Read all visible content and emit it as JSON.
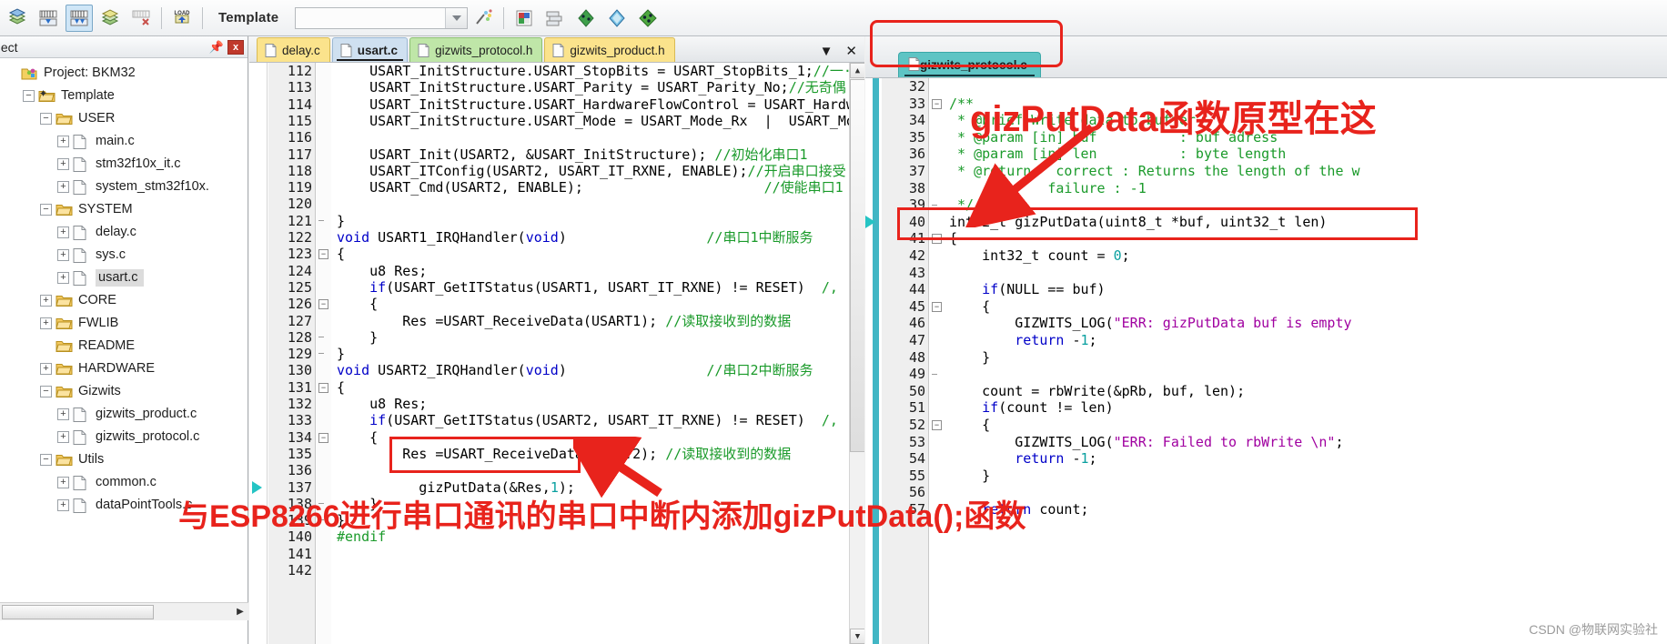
{
  "toolbar": {
    "template_label": "Template",
    "combo_value": "",
    "icons": [
      {
        "name": "build-target-icon"
      },
      {
        "name": "build-icon"
      },
      {
        "name": "rebuild-icon"
      },
      {
        "name": "batch-build-icon"
      },
      {
        "name": "stop-build-icon"
      },
      {
        "name": "load-icon",
        "label": "LOAD"
      },
      {
        "name": "target-options-icon"
      },
      {
        "name": "manage-components-icon"
      },
      {
        "name": "manage-project-items-icon"
      },
      {
        "name": "configuration-wizard-icon"
      },
      {
        "name": "pack-installer-icon"
      },
      {
        "name": "manage-run-time-icon"
      }
    ]
  },
  "project_panel": {
    "title": "oject",
    "close_label": "x",
    "tree": [
      {
        "label": "Project: BKM32",
        "depth": 0,
        "expander": "",
        "icon": "project-icon"
      },
      {
        "label": "Template",
        "depth": 1,
        "expander": "-",
        "icon": "target-folder-icon"
      },
      {
        "label": "USER",
        "depth": 2,
        "expander": "-",
        "icon": "folder-icon"
      },
      {
        "label": "main.c",
        "depth": 3,
        "expander": "+",
        "icon": "c-file-icon"
      },
      {
        "label": "stm32f10x_it.c",
        "depth": 3,
        "expander": "+",
        "icon": "c-file-icon"
      },
      {
        "label": "system_stm32f10x.",
        "depth": 3,
        "expander": "+",
        "icon": "c-file-icon"
      },
      {
        "label": "SYSTEM",
        "depth": 2,
        "expander": "-",
        "icon": "folder-icon"
      },
      {
        "label": "delay.c",
        "depth": 3,
        "expander": "+",
        "icon": "c-file-icon"
      },
      {
        "label": "sys.c",
        "depth": 3,
        "expander": "+",
        "icon": "c-file-icon"
      },
      {
        "label": "usart.c",
        "depth": 3,
        "expander": "+",
        "icon": "c-file-icon",
        "selected": true
      },
      {
        "label": "CORE",
        "depth": 2,
        "expander": "+",
        "icon": "folder-icon"
      },
      {
        "label": "FWLIB",
        "depth": 2,
        "expander": "+",
        "icon": "folder-icon"
      },
      {
        "label": "README",
        "depth": 2,
        "expander": "",
        "icon": "folder-icon"
      },
      {
        "label": "HARDWARE",
        "depth": 2,
        "expander": "+",
        "icon": "folder-icon"
      },
      {
        "label": "Gizwits",
        "depth": 2,
        "expander": "-",
        "icon": "folder-icon"
      },
      {
        "label": "gizwits_product.c",
        "depth": 3,
        "expander": "+",
        "icon": "c-file-icon"
      },
      {
        "label": "gizwits_protocol.c",
        "depth": 3,
        "expander": "+",
        "icon": "c-file-icon"
      },
      {
        "label": "Utils",
        "depth": 2,
        "expander": "-",
        "icon": "folder-icon"
      },
      {
        "label": "common.c",
        "depth": 3,
        "expander": "+",
        "icon": "c-file-icon"
      },
      {
        "label": "dataPointTools.c",
        "depth": 3,
        "expander": "+",
        "icon": "c-file-icon"
      }
    ]
  },
  "left_editor": {
    "tabs": [
      {
        "label": "delay.c",
        "color": "yellow",
        "active": false
      },
      {
        "label": "usart.c",
        "color": "blue",
        "active": true
      },
      {
        "label": "gizwits_protocol.h",
        "color": "green",
        "active": false
      },
      {
        "label": "gizwits_product.h",
        "color": "yellow2",
        "active": false
      }
    ],
    "tab_menu_icon": "tab-list-icon",
    "tab_close_icon": "close-icon",
    "first_line": 112,
    "lines": [
      {
        "n": 112,
        "segs": [
          {
            "t": "    USART_InitStructure.USART_StopBits = USART_StopBits_1;",
            "c": ""
          },
          {
            "t": "//一·",
            "c": "cmt"
          }
        ]
      },
      {
        "n": 113,
        "segs": [
          {
            "t": "    USART_InitStructure.USART_Parity = USART_Parity_No;",
            "c": ""
          },
          {
            "t": "//无奇偶",
            "c": "cmt"
          }
        ]
      },
      {
        "n": 114,
        "segs": [
          {
            "t": "    USART_InitStructure.USART_HardwareFlowControl = USART_Hardw",
            "c": ""
          }
        ]
      },
      {
        "n": 115,
        "segs": [
          {
            "t": "    USART_InitStructure.USART_Mode = USART_Mode_Rx  |  USART_Mod",
            "c": ""
          }
        ]
      },
      {
        "n": 116,
        "segs": []
      },
      {
        "n": 117,
        "segs": [
          {
            "t": "    USART_Init(USART2, &USART_InitStructure); ",
            "c": ""
          },
          {
            "t": "//初始化串口1",
            "c": "cmt"
          }
        ]
      },
      {
        "n": 118,
        "segs": [
          {
            "t": "    USART_ITConfig(USART2, USART_IT_RXNE, ENABLE);",
            "c": ""
          },
          {
            "t": "//开启串口接受",
            "c": "cmt"
          }
        ]
      },
      {
        "n": 119,
        "segs": [
          {
            "t": "    USART_Cmd(USART2, ENABLE);                      ",
            "c": ""
          },
          {
            "t": "//使能串口1",
            "c": "cmt"
          }
        ]
      },
      {
        "n": 120,
        "segs": []
      },
      {
        "n": 121,
        "fold": "end",
        "segs": [
          {
            "t": "}",
            "c": ""
          }
        ]
      },
      {
        "n": 122,
        "segs": [
          {
            "t": "void",
            "c": "kw"
          },
          {
            "t": " USART1_IRQHandler(",
            "c": ""
          },
          {
            "t": "void",
            "c": "kw"
          },
          {
            "t": ")                 ",
            "c": ""
          },
          {
            "t": "//串口1中断服务",
            "c": "cmt"
          }
        ]
      },
      {
        "n": 123,
        "fold": "start",
        "segs": [
          {
            "t": "{",
            "c": ""
          }
        ]
      },
      {
        "n": 124,
        "segs": [
          {
            "t": "    u8 Res;",
            "c": ""
          }
        ]
      },
      {
        "n": 125,
        "segs": [
          {
            "t": "    ",
            "c": ""
          },
          {
            "t": "if",
            "c": "kw"
          },
          {
            "t": "(USART_GetITStatus(USART1, USART_IT_RXNE) != RESET)  ",
            "c": ""
          },
          {
            "t": "/,",
            "c": "cmt"
          }
        ]
      },
      {
        "n": 126,
        "fold": "start",
        "segs": [
          {
            "t": "    {",
            "c": ""
          }
        ]
      },
      {
        "n": 127,
        "segs": [
          {
            "t": "        Res =USART_ReceiveData(USART1); ",
            "c": ""
          },
          {
            "t": "//读取接收到的数据",
            "c": "cmt"
          }
        ]
      },
      {
        "n": 128,
        "fold": "end",
        "segs": [
          {
            "t": "    }",
            "c": ""
          }
        ]
      },
      {
        "n": 129,
        "fold": "end",
        "segs": [
          {
            "t": "}",
            "c": ""
          }
        ]
      },
      {
        "n": 130,
        "segs": [
          {
            "t": "void",
            "c": "kw"
          },
          {
            "t": " USART2_IRQHandler(",
            "c": ""
          },
          {
            "t": "void",
            "c": "kw"
          },
          {
            "t": ")                 ",
            "c": ""
          },
          {
            "t": "//串口2中断服务",
            "c": "cmt"
          }
        ]
      },
      {
        "n": 131,
        "fold": "start",
        "segs": [
          {
            "t": "{",
            "c": ""
          }
        ]
      },
      {
        "n": 132,
        "segs": [
          {
            "t": "    u8 Res;",
            "c": ""
          }
        ]
      },
      {
        "n": 133,
        "segs": [
          {
            "t": "    ",
            "c": ""
          },
          {
            "t": "if",
            "c": "kw"
          },
          {
            "t": "(USART_GetITStatus(USART2, USART_IT_RXNE) != RESET)  ",
            "c": ""
          },
          {
            "t": "/,",
            "c": "cmt"
          }
        ]
      },
      {
        "n": 134,
        "fold": "start",
        "segs": [
          {
            "t": "    {",
            "c": ""
          }
        ]
      },
      {
        "n": 135,
        "segs": [
          {
            "t": "        Res =USART_ReceiveData(USART2); ",
            "c": ""
          },
          {
            "t": "//读取接收到的数据",
            "c": "cmt"
          }
        ]
      },
      {
        "n": 136,
        "segs": []
      },
      {
        "n": 137,
        "marker": true,
        "segs": [
          {
            "t": "          gizPutData(&Res,",
            "c": ""
          },
          {
            "t": "1",
            "c": "num"
          },
          {
            "t": ");",
            "c": ""
          }
        ]
      },
      {
        "n": 138,
        "fold": "end",
        "segs": [
          {
            "t": "    }",
            "c": ""
          }
        ]
      },
      {
        "n": 139,
        "fold": "end",
        "segs": [
          {
            "t": "}",
            "c": ""
          }
        ]
      },
      {
        "n": 140,
        "segs": [
          {
            "t": "#endif",
            "c": "cmt"
          }
        ]
      },
      {
        "n": 141,
        "segs": []
      },
      {
        "n": 142,
        "segs": []
      }
    ]
  },
  "right_editor": {
    "tab": {
      "label": "gizwits_protocol.c",
      "color": "teal"
    },
    "lines": [
      {
        "n": 32,
        "segs": []
      },
      {
        "n": 33,
        "fold": "start",
        "segs": [
          {
            "t": "/**",
            "c": "cmt"
          }
        ]
      },
      {
        "n": 34,
        "segs": [
          {
            "t": " * @brief Write data to buffer",
            "c": "cmt"
          }
        ]
      },
      {
        "n": 35,
        "segs": [
          {
            "t": " * @param [in] buf          : buf adress",
            "c": "cmt"
          }
        ]
      },
      {
        "n": 36,
        "segs": [
          {
            "t": " * @param [in] len          : byte length",
            "c": "cmt"
          }
        ]
      },
      {
        "n": 37,
        "segs": [
          {
            "t": " * @return   correct : Returns the length of the w",
            "c": "cmt"
          }
        ]
      },
      {
        "n": 38,
        "segs": [
          {
            "t": "            failure : -1",
            "c": "cmt"
          }
        ]
      },
      {
        "n": 39,
        "fold": "end",
        "segs": [
          {
            "t": " */",
            "c": "cmt"
          }
        ]
      },
      {
        "n": 40,
        "marker": true,
        "segs": [
          {
            "t": "int32_t gizPutData(uint8_t *buf, uint32_t len)",
            "c": ""
          }
        ]
      },
      {
        "n": 41,
        "fold": "start",
        "segs": [
          {
            "t": "{",
            "c": ""
          }
        ]
      },
      {
        "n": 42,
        "segs": [
          {
            "t": "    int32_t count = ",
            "c": ""
          },
          {
            "t": "0",
            "c": "num"
          },
          {
            "t": ";",
            "c": ""
          }
        ]
      },
      {
        "n": 43,
        "segs": []
      },
      {
        "n": 44,
        "segs": [
          {
            "t": "    ",
            "c": ""
          },
          {
            "t": "if",
            "c": "kw"
          },
          {
            "t": "(NULL == buf)",
            "c": ""
          }
        ]
      },
      {
        "n": 45,
        "fold": "start",
        "segs": [
          {
            "t": "    {",
            "c": ""
          }
        ]
      },
      {
        "n": 46,
        "segs": [
          {
            "t": "        GIZWITS_LOG(",
            "c": ""
          },
          {
            "t": "\"ERR: gizPutData buf is empty",
            "c": "str"
          }
        ]
      },
      {
        "n": 47,
        "segs": [
          {
            "t": "        ",
            "c": ""
          },
          {
            "t": "return",
            "c": "kw"
          },
          {
            "t": " -",
            "c": ""
          },
          {
            "t": "1",
            "c": "num"
          },
          {
            "t": ";",
            "c": ""
          }
        ]
      },
      {
        "n": 48,
        "segs": [
          {
            "t": "    }",
            "c": ""
          }
        ]
      },
      {
        "n": 49,
        "fold": "end",
        "segs": []
      },
      {
        "n": 50,
        "segs": [
          {
            "t": "    count = rbWrite(&pRb, buf, len);",
            "c": ""
          }
        ]
      },
      {
        "n": 51,
        "segs": [
          {
            "t": "    ",
            "c": ""
          },
          {
            "t": "if",
            "c": "kw"
          },
          {
            "t": "(count != len)",
            "c": ""
          }
        ]
      },
      {
        "n": 52,
        "fold": "start",
        "segs": [
          {
            "t": "    {",
            "c": ""
          }
        ]
      },
      {
        "n": 53,
        "segs": [
          {
            "t": "        GIZWITS_LOG(",
            "c": ""
          },
          {
            "t": "\"ERR: Failed to rbWrite \\n\"",
            "c": "str"
          },
          {
            "t": ";",
            "c": ""
          }
        ]
      },
      {
        "n": 54,
        "segs": [
          {
            "t": "        ",
            "c": ""
          },
          {
            "t": "return",
            "c": "kw"
          },
          {
            "t": " -",
            "c": ""
          },
          {
            "t": "1",
            "c": "num"
          },
          {
            "t": ";",
            "c": ""
          }
        ]
      },
      {
        "n": 55,
        "segs": [
          {
            "t": "    }",
            "c": ""
          }
        ]
      },
      {
        "n": 56,
        "segs": []
      },
      {
        "n": 57,
        "segs": [
          {
            "t": "    ",
            "c": ""
          },
          {
            "t": "return",
            "c": "kw"
          },
          {
            "t": " count;",
            "c": ""
          }
        ]
      }
    ]
  },
  "annotations": {
    "color": "#e8231c",
    "tab_callout_text": "gizPutData函数原型在这",
    "bottom_text": "与ESP8266进行串口通讯的串口中断内添加gizPutData();函数"
  },
  "watermark": "CSDN @物联网实验社"
}
